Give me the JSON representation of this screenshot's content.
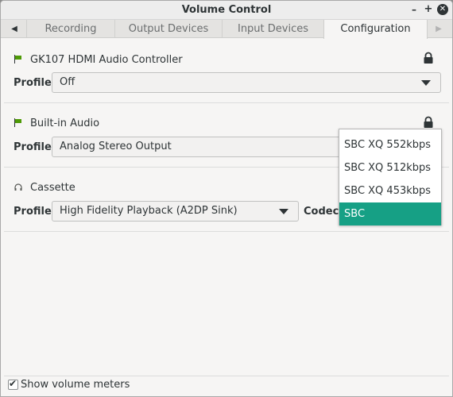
{
  "window": {
    "title": "Volume Control"
  },
  "tabs": [
    "Recording",
    "Output Devices",
    "Input Devices",
    "Configuration"
  ],
  "active_tab": "Configuration",
  "devices": [
    {
      "name": "GK107 HDMI Audio Controller",
      "icon": "sound-card-icon",
      "profile_label": "Profile:",
      "profile": "Off",
      "locked": true
    },
    {
      "name": "Built-in Audio",
      "icon": "sound-card-icon",
      "profile_label": "Profile:",
      "profile": "Analog Stereo Output",
      "locked": true
    },
    {
      "name": "Cassette",
      "icon": "headphones-icon",
      "profile_label": "Profile:",
      "profile": "High Fidelity Playback (A2DP Sink)",
      "codec_label": "Codec:"
    }
  ],
  "codec_menu": {
    "options": [
      "SBC XQ 552kbps",
      "SBC XQ 512kbps",
      "SBC XQ 453kbps",
      "SBC"
    ],
    "selected": "SBC"
  },
  "footer": {
    "show_meters_label": "Show volume meters",
    "show_meters_checked": true
  },
  "colors": {
    "selection": "#16a085",
    "flag": "#4e9a06"
  }
}
